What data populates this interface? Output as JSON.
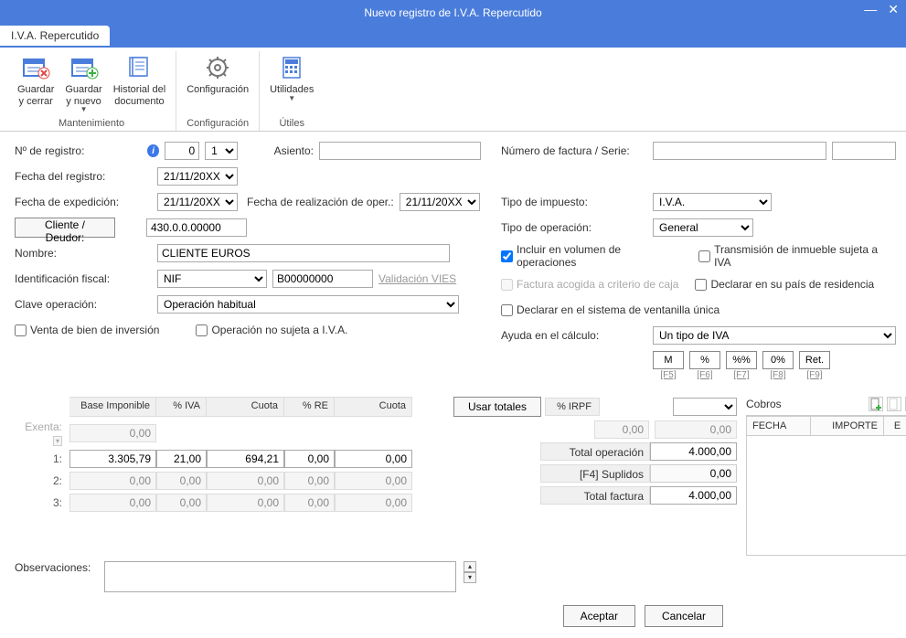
{
  "window": {
    "title": "Nuevo registro de I.V.A. Repercutido"
  },
  "tab": {
    "label": "I.V.A. Repercutido"
  },
  "ribbon": {
    "save_close": "Guardar\ny cerrar",
    "save_new": "Guardar\ny nuevo",
    "history": "Historial del\ndocumento",
    "group_maint": "Mantenimiento",
    "config": "Configuración",
    "group_config": "Configuración",
    "utils": "Utilidades",
    "group_utils": "Útiles"
  },
  "form": {
    "nregistro_lbl": "Nº de registro:",
    "nregistro_v1": "0",
    "nregistro_v2": "1",
    "fecharegistro_lbl": "Fecha del registro:",
    "fecharegistro_v": "21/11/20XX",
    "fechaexp_lbl": "Fecha de expedición:",
    "fechaexp_v": "21/11/20XX",
    "fechareal_lbl": "Fecha de realización de oper.:",
    "fechareal_v": "21/11/20XX",
    "cliente_btn": "Cliente / Deudor:",
    "cliente_v": "430.0.0.00000",
    "nombre_lbl": "Nombre:",
    "nombre_v": "CLIENTE EUROS",
    "idfiscal_lbl": "Identificación fiscal:",
    "idfiscal_type": "NIF",
    "idfiscal_v": "B00000000",
    "vies": "Validación VIES",
    "claveop_lbl": "Clave operación:",
    "claveop_v": "Operación habitual",
    "chk_ventabien": "Venta de bien de inversión",
    "chk_opnosujeta": "Operación no sujeta a I.V.A.",
    "asiento_lbl": "Asiento:",
    "numfact_lbl": "Número de factura / Serie:",
    "tipoimp_lbl": "Tipo de impuesto:",
    "tipoimp_v": "I.V.A.",
    "tipoop_lbl": "Tipo de operación:",
    "tipoop_v": "General",
    "chk_incluir": "Incluir en volumen de operaciones",
    "chk_transm": "Transmisión de inmueble sujeta a IVA",
    "chk_fact_caja": "Factura acogida a criterio de caja",
    "chk_declarar_pais": "Declarar en su país de residencia",
    "chk_ventanilla": "Declarar en el sistema de ventanilla única",
    "ayuda_lbl": "Ayuda en el cálculo:",
    "ayuda_v": "Un tipo de IVA",
    "calc": {
      "m": "M",
      "pct": "%",
      "pctpct": "%%",
      "zero": "0%",
      "ret": "Ret.",
      "f5": "[F5]",
      "f6": "[F6]",
      "f7": "[F7]",
      "f8": "[F8]",
      "f9": "[F9]"
    }
  },
  "grid": {
    "hdr_base": "Base Imponible",
    "hdr_iva": "% IVA",
    "hdr_cuota": "Cuota",
    "hdr_re": "% RE",
    "hdr_cuota2": "Cuota",
    "usar_totales": "Usar totales",
    "hdr_irpf": "% IRPF",
    "exenta_lbl": "Exenta:",
    "exenta_base": "0,00",
    "r1_lbl": "1:",
    "r1_base": "3.305,79",
    "r1_iva": "21,00",
    "r1_cuota": "694,21",
    "r1_re": "0,00",
    "r1_cuota2": "0,00",
    "r2_lbl": "2:",
    "r2_base": "0,00",
    "r2_iva": "0,00",
    "r2_cuota": "0,00",
    "r2_re": "0,00",
    "r2_cuota2": "0,00",
    "r3_lbl": "3:",
    "r3_base": "0,00",
    "r3_iva": "0,00",
    "r3_cuota": "0,00",
    "r3_re": "0,00",
    "r3_cuota2": "0,00",
    "irpf_v1": "0,00",
    "irpf_v2": "0,00",
    "total_op_lbl": "Total operación",
    "total_op_v": "4.000,00",
    "suplidos_lbl": "[F4] Suplidos",
    "suplidos_v": "0,00",
    "total_fact_lbl": "Total factura",
    "total_fact_v": "4.000,00"
  },
  "cobros": {
    "title": "Cobros",
    "col_fecha": "FECHA",
    "col_importe": "IMPORTE",
    "col_e": "E"
  },
  "obs": {
    "lbl": "Observaciones:"
  },
  "buttons": {
    "aceptar": "Aceptar",
    "cancelar": "Cancelar"
  }
}
